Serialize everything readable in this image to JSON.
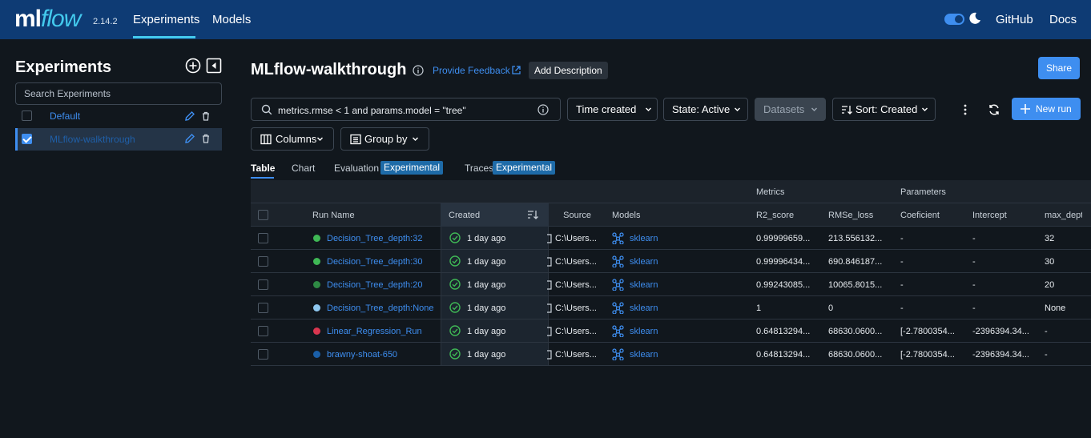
{
  "brand": {
    "ml": "ml",
    "flow": "flow",
    "version": "2.14.2"
  },
  "nav": {
    "experiments": "Experiments",
    "models": "Models",
    "github": "GitHub",
    "docs": "Docs"
  },
  "sidebar": {
    "title": "Experiments",
    "search_placeholder": "Search Experiments",
    "items": [
      {
        "name": "Default",
        "checked": false
      },
      {
        "name": "MLflow-walkthrough",
        "checked": true
      }
    ]
  },
  "header": {
    "title": "MLflow-walkthrough",
    "feedback": "Provide Feedback",
    "add_description": "Add Description",
    "share": "Share"
  },
  "toolbar": {
    "search_query": "metrics.rmse < 1 and params.model = \"tree\"",
    "time_created": "Time created",
    "state": "State: Active",
    "datasets": "Datasets",
    "sort": "Sort: Created",
    "new_run": "New run",
    "columns": "Columns",
    "group_by": "Group by"
  },
  "tabs": {
    "table": "Table",
    "chart": "Chart",
    "evaluation": "Evaluation",
    "traces": "Traces",
    "experimental": "Experimental"
  },
  "table": {
    "groups": {
      "metrics": "Metrics",
      "parameters": "Parameters"
    },
    "headers": {
      "run_name": "Run Name",
      "created": "Created",
      "source": "Source",
      "models": "Models",
      "r2": "R2_score",
      "rmse": "RMSe_loss",
      "coef": "Coeficient",
      "intercept": "Intercept",
      "max_depth": "max_depth"
    },
    "rows": [
      {
        "name": "Decision_Tree_depth:32",
        "color": "#3fb855",
        "created": "1 day ago",
        "source": "C:\\Users...",
        "model": "sklearn",
        "r2": "0.99999659...",
        "rmse": "213.556132...",
        "coef": "-",
        "intercept": "-",
        "max_depth": "32"
      },
      {
        "name": "Decision_Tree_depth:30",
        "color": "#3fb855",
        "created": "1 day ago",
        "source": "C:\\Users...",
        "model": "sklearn",
        "r2": "0.99996434...",
        "rmse": "690.846187...",
        "coef": "-",
        "intercept": "-",
        "max_depth": "30"
      },
      {
        "name": "Decision_Tree_depth:20",
        "color": "#2e8a44",
        "created": "1 day ago",
        "source": "C:\\Users...",
        "model": "sklearn",
        "r2": "0.99243085...",
        "rmse": "10065.8015...",
        "coef": "-",
        "intercept": "-",
        "max_depth": "20"
      },
      {
        "name": "Decision_Tree_depth:None",
        "color": "#8fc8f0",
        "created": "1 day ago",
        "source": "C:\\Users...",
        "model": "sklearn",
        "r2": "1",
        "rmse": "0",
        "coef": "-",
        "intercept": "-",
        "max_depth": "None"
      },
      {
        "name": "Linear_Regression_Run",
        "color": "#d9364f",
        "created": "1 day ago",
        "source": "C:\\Users...",
        "model": "sklearn",
        "r2": "0.64813294...",
        "rmse": "68630.0600...",
        "coef": "[-2.7800354...",
        "intercept": "-2396394.34...",
        "max_depth": "-"
      },
      {
        "name": "brawny-shoat-650",
        "color": "#1a5fa8",
        "created": "1 day ago",
        "source": "C:\\Users...",
        "model": "sklearn",
        "r2": "0.64813294...",
        "rmse": "68630.0600...",
        "coef": "[-2.7800354...",
        "intercept": "-2396394.34...",
        "max_depth": "-"
      }
    ]
  },
  "colors": {
    "topbar": "#0e3b74",
    "accent": "#3e8ef0",
    "logo_flow": "#43c9ed",
    "badge": "#1e6ba8",
    "success": "#3fb855"
  }
}
